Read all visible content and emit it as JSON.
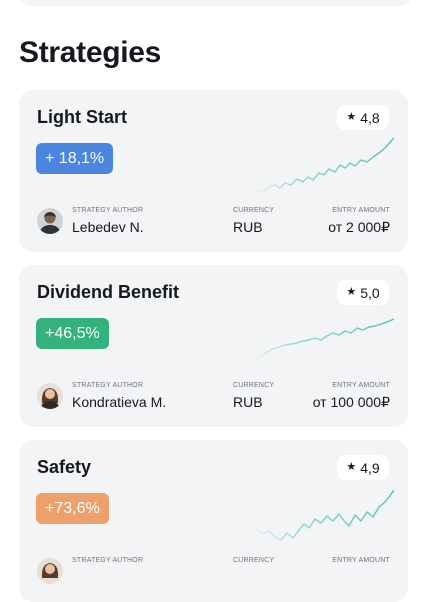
{
  "page": {
    "title": "Strategies"
  },
  "colors": {
    "card_bg": "#f3f4f6",
    "sparkline": "#6fd1c4",
    "badge_blue": "#4a86e0",
    "badge_green": "#34b27d",
    "badge_orange": "#eda06a"
  },
  "strategies": [
    {
      "name": "Light Start",
      "rating": "4,8",
      "return": "+ 18,1%",
      "badge_color": "#4a86e0",
      "author_label": "STRATEGY AUTHOR",
      "author": "Lebedev N.",
      "currency_label": "CURRENCY",
      "currency": "RUB",
      "entry_label": "ENTRY AMOUNT",
      "entry_amount": "от 2 000₽",
      "avatar_icon": "avatar-male-photo"
    },
    {
      "name": "Dividend Benefit",
      "rating": "5,0",
      "return": "+46,5%",
      "badge_color": "#34b27d",
      "author_label": "STRATEGY AUTHOR",
      "author": "Kondratieva M.",
      "currency_label": "CURRENCY",
      "currency": "RUB",
      "entry_label": "ENTRY AMOUNT",
      "entry_amount": "от 100 000₽",
      "avatar_icon": "avatar-female-photo"
    },
    {
      "name": "Safety",
      "rating": "4,9",
      "return": "+73,6%",
      "badge_color": "#eda06a",
      "author_label": "STRATEGY AUTHOR",
      "author": "",
      "currency_label": "CURRENCY",
      "currency": "",
      "entry_label": "ENTRY AMOUNT",
      "entry_amount": "",
      "avatar_icon": "avatar-female-photo"
    }
  ]
}
